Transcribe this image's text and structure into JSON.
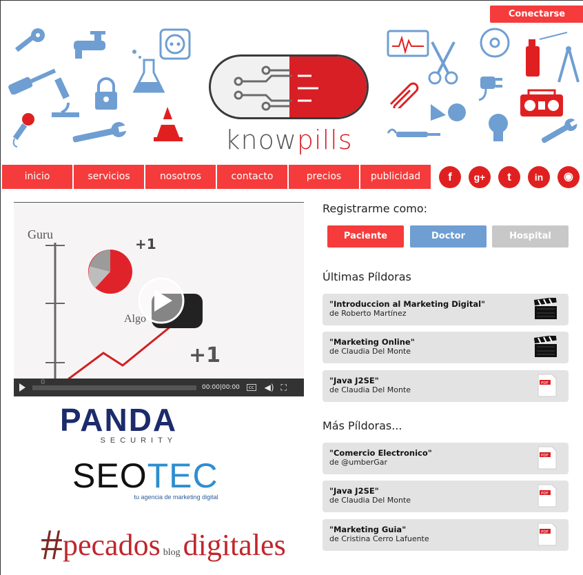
{
  "header": {
    "connect_label": "Conectarse",
    "logo": {
      "word1": "know",
      "word2": "pills"
    }
  },
  "nav": {
    "items": [
      {
        "label": "inicio"
      },
      {
        "label": "servicios"
      },
      {
        "label": "nosotros"
      },
      {
        "label": "contacto"
      },
      {
        "label": "precios"
      },
      {
        "label": "publicidad"
      }
    ],
    "social": [
      {
        "icon": "facebook-icon",
        "glyph": "f"
      },
      {
        "icon": "google-plus-icon",
        "glyph": "g+"
      },
      {
        "icon": "twitter-icon",
        "glyph": "t"
      },
      {
        "icon": "linkedin-icon",
        "glyph": "in"
      },
      {
        "icon": "rss-icon",
        "glyph": "◉"
      }
    ]
  },
  "video": {
    "label_guru": "Guru",
    "label_algo": "Algo",
    "plus1_a": "+1",
    "plus1_b": "+1",
    "axis_zero": "0",
    "time": "00:00|00:00",
    "cc": "cc"
  },
  "sponsors": {
    "panda": {
      "main": "PANDA",
      "sub": "SECURITY"
    },
    "seotec": {
      "seo": "SEO",
      "tec": "TEC",
      "sub": "tu agencia de marketing digital"
    },
    "pecados": {
      "hash": "#",
      "w1": "pecados",
      "blog": "blog",
      "w2": "digitales"
    }
  },
  "register": {
    "title": "Registrarme como:",
    "buttons": [
      {
        "label": "Paciente",
        "color": "#f53b3b"
      },
      {
        "label": "Doctor",
        "color": "#6f9ed2"
      },
      {
        "label": "Hospital",
        "color": "#c8c8c8"
      }
    ]
  },
  "latest": {
    "title": "Últimas Píldoras",
    "items": [
      {
        "title": "\"Introduccion al Marketing Digital\"",
        "author": "de Roberto Martínez",
        "icon": "clapperboard-icon"
      },
      {
        "title": "\"Marketing Online\"",
        "author": "de Claudia Del Monte",
        "icon": "clapperboard-icon"
      },
      {
        "title": "\"Java J2SE\"",
        "author": "de Claudia Del Monte",
        "icon": "pdf-icon"
      }
    ]
  },
  "more": {
    "title": "Más Píldoras...",
    "items": [
      {
        "title": "\"Comercio Electronico\"",
        "author": "de @umberGar",
        "icon": "pdf-icon"
      },
      {
        "title": "\"Java J2SE\"",
        "author": "de Claudia Del Monte",
        "icon": "pdf-icon"
      },
      {
        "title": "\"Marketing Guia\"",
        "author": "de Cristina Cerro Lafuente",
        "icon": "pdf-icon"
      }
    ]
  },
  "pdf_label": "PDF"
}
